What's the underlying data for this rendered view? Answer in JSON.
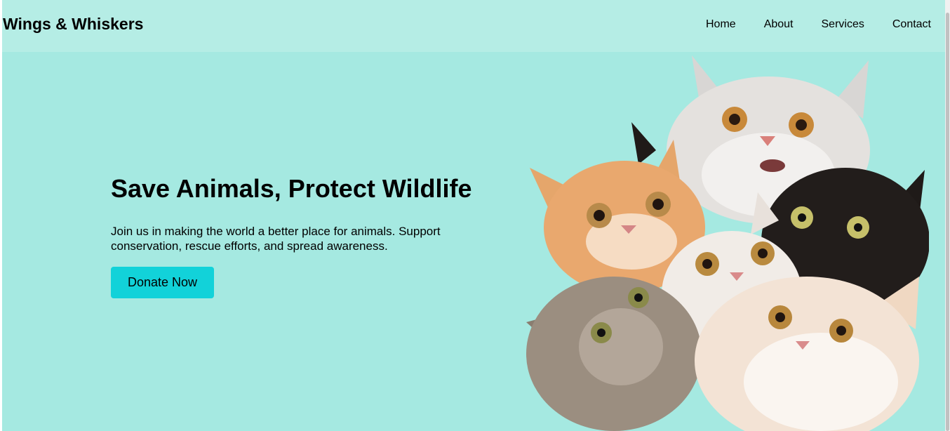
{
  "header": {
    "brand": "Wings & Whiskers",
    "nav": [
      {
        "label": "Home"
      },
      {
        "label": "About"
      },
      {
        "label": "Services"
      },
      {
        "label": "Contact"
      }
    ]
  },
  "hero": {
    "title": "Save Animals, Protect Wildlife",
    "text": "Join us in making the world a better place for animals. Support conservation, rescue efforts, and spread awareness.",
    "button_label": "Donate Now",
    "image_alt": "Group of cats"
  },
  "colors": {
    "page_background": "#a5e9e1",
    "header_background": "#b5ede5",
    "button_background": "#12d2d9"
  }
}
